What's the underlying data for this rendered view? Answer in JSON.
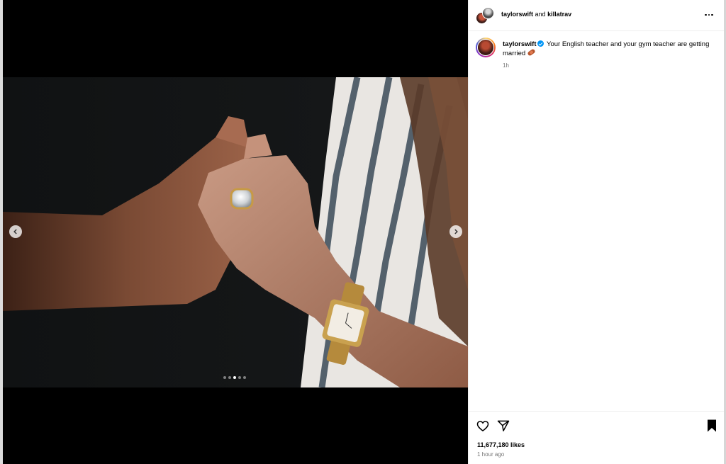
{
  "post": {
    "media": {
      "carousel_total": 5,
      "carousel_active_index": 2,
      "photo_description_icon": "engagement-ring-photo"
    },
    "header": {
      "user1": "taylorswift",
      "and_text": "and",
      "user2": "killatrav",
      "more_icon": "more-dots-icon"
    },
    "caption": {
      "username": "taylorswift",
      "verified_icon": "verified-badge-icon",
      "text": "Your English teacher and your gym teacher are getting married",
      "emoji_icon": "football-emoji-icon",
      "time": "1h"
    },
    "actions": {
      "like_icon": "heart-icon",
      "share_icon": "share-icon",
      "save_icon": "bookmark-icon",
      "likes": "11,677,180 likes",
      "posted_ago": "1 hour ago"
    }
  },
  "colors": {
    "verified": "#0095f6",
    "secondary_text": "#737373",
    "divider": "#efefef"
  }
}
